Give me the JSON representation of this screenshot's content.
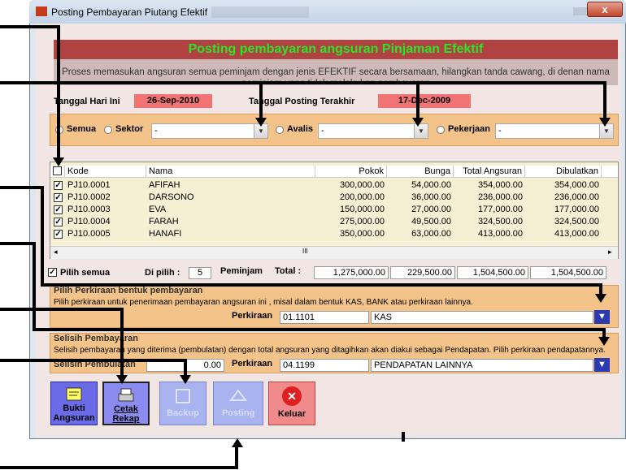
{
  "window": {
    "title": "Posting Pembayaran Piutang Efektif",
    "close": "x"
  },
  "header": {
    "title": "Posting pembayaran angsuran Pinjaman Efektif",
    "description": "Proses memasukan angsuran semua peminjam dengan jenis EFEKTIF  secara bersamaan, hilangkan tanda cawang, di denan nama peminjam yang tidak melakukan pembayaran"
  },
  "dates": {
    "today_label": "Tanggal Hari Ini",
    "today_value": "26-Sep-2010",
    "last_posting_label": "Tanggal Posting Terakhir",
    "last_posting_value": "17-Dec-2009"
  },
  "filters": {
    "semua": "Semua",
    "sektor": "Sektor",
    "avalis": "Avalis",
    "pekerjaan": "Pekerjaan",
    "combo_value": "-"
  },
  "grid": {
    "columns": [
      "Kode",
      "Nama",
      "Pokok",
      "Bunga",
      "Total Angsuran",
      "Dibulatkan"
    ],
    "rows": [
      {
        "kode": "PJ10.0001",
        "nama": "AFIFAH",
        "pokok": "300,000.00",
        "bunga": "54,000.00",
        "total": "354,000.00",
        "bulat": "354,000.00"
      },
      {
        "kode": "PJ10.0002",
        "nama": "DARSONO",
        "pokok": "200,000.00",
        "bunga": "36,000.00",
        "total": "236,000.00",
        "bulat": "236,000.00"
      },
      {
        "kode": "PJ10.0003",
        "nama": "EVA",
        "pokok": "150,000.00",
        "bunga": "27,000.00",
        "total": "177,000.00",
        "bulat": "177,000.00"
      },
      {
        "kode": "PJ10.0004",
        "nama": "FARAH",
        "pokok": "275,000.00",
        "bunga": "49,500.00",
        "total": "324,500.00",
        "bulat": "324,500.00"
      },
      {
        "kode": "PJ10.0005",
        "nama": "HANAFI",
        "pokok": "350,000.00",
        "bunga": "63,000.00",
        "total": "413,000.00",
        "bulat": "413,000.00"
      }
    ],
    "scroll_thumb": "III"
  },
  "totals": {
    "pilih_semua": "Pilih semua",
    "dipilih_label": "Di pilih :",
    "dipilih_value": "5",
    "peminjam": "Peminjam",
    "total_label": "Total :",
    "pokok": "1,275,000.00",
    "bunga": "229,500.00",
    "angsuran": "1,504,500.00",
    "bulat": "1,504,500.00"
  },
  "perkiraan_section": {
    "title": "Pilih Perkiraan bentuk pembayaran",
    "text": "Pilih perkiraan untuk penerimaan pembayaran angsuran ini , misal dalam bentuk KAS, BANK atau perkiraan lainnya.",
    "label": "Perkiraan",
    "code": "01.1101",
    "name": "KAS"
  },
  "selisih_section": {
    "title": "Selisih Pembayaran",
    "text": "Selisih pembayaran yang diterima (pembulatan) dengan total angsuran yang ditagihkan  akan diakui sebagai  Pendapatan. Pilih perkiraan pendapatannya.",
    "amount_label": "Selisih Pembulatan",
    "amount": "0.00",
    "label": "Perkiraan",
    "code": "04.1199",
    "name": "PENDAPATAN LAINNYA"
  },
  "buttons": {
    "bukti": "Bukti Angsuran",
    "cetak": "Cetak Rekap",
    "backup": "Backup",
    "posting": "Posting",
    "keluar": "Keluar"
  },
  "colors": {
    "header_bg": "#b04242",
    "header_text": "#26e826",
    "panel": "#f3c38a",
    "date_box": "#f27373",
    "dropdown_blue": "#2a3ab0"
  }
}
